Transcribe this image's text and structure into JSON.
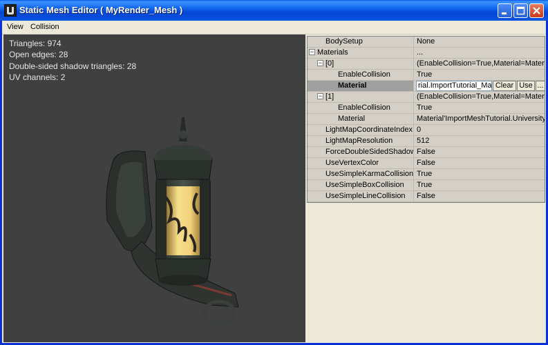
{
  "window": {
    "title": "Static Mesh Editor ( MyRender_Mesh )"
  },
  "menu": {
    "items": [
      "View",
      "Collision"
    ]
  },
  "stats": [
    "Triangles:  974",
    "Open edges: 28",
    "Double-sided shadow triangles:  28",
    "UV channels:  2"
  ],
  "properties": {
    "rows": [
      {
        "name": "BodySetup",
        "value": "None",
        "level": 1,
        "expander": ""
      },
      {
        "name": "Materials",
        "value": "...",
        "level": 0,
        "expander": "⊟"
      },
      {
        "name": "[0]",
        "value": "(EnableCollision=True,Material=Materi...",
        "level": 1,
        "expander": "⊟"
      },
      {
        "name": "EnableCollision",
        "value": "True",
        "level": 2,
        "expander": ""
      },
      {
        "name": "Material",
        "value": "rial.ImportTutorial_Mat'",
        "level": 2,
        "expander": "",
        "selected": true
      },
      {
        "name": "[1]",
        "value": "(EnableCollision=True,Material=Materi...",
        "level": 1,
        "expander": "⊟"
      },
      {
        "name": "EnableCollision",
        "value": "True",
        "level": 2,
        "expander": ""
      },
      {
        "name": "Material",
        "value": "Material'ImportMeshTutorial.University...",
        "level": 2,
        "expander": ""
      },
      {
        "name": "LightMapCoordinateIndex",
        "value": "0",
        "level": 1,
        "expander": ""
      },
      {
        "name": "LightMapResolution",
        "value": "512",
        "level": 1,
        "expander": ""
      },
      {
        "name": "ForceDoubleSidedShadow...",
        "value": "False",
        "level": 1,
        "expander": ""
      },
      {
        "name": "UseVertexColor",
        "value": "False",
        "level": 1,
        "expander": ""
      },
      {
        "name": "UseSimpleKarmaCollision",
        "value": "True",
        "level": 1,
        "expander": ""
      },
      {
        "name": "UseSimpleBoxCollision",
        "value": "True",
        "level": 1,
        "expander": ""
      },
      {
        "name": "UseSimpleLineCollision",
        "value": "False",
        "level": 1,
        "expander": ""
      }
    ],
    "edit_buttons": {
      "clear": "Clear",
      "use": "Use",
      "browse": "..."
    }
  },
  "colors": {
    "titlebar": "#0a5ae8",
    "viewport_bg": "#404040",
    "selected_row": "#a0a0a0",
    "lantern_glow": "#f2d27a"
  }
}
